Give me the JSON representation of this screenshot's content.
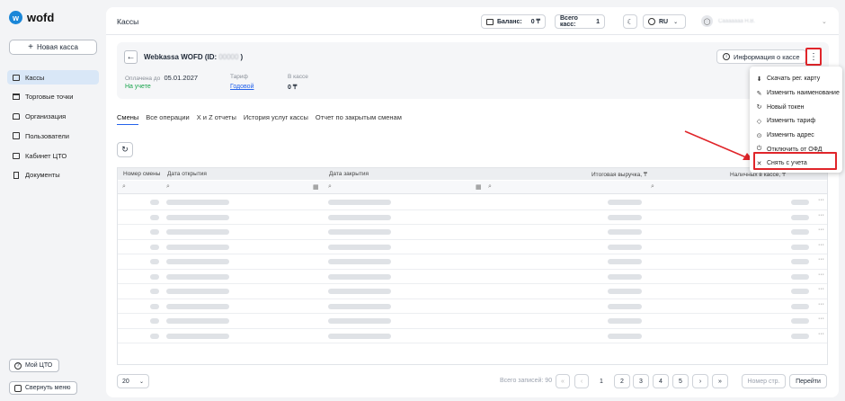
{
  "sidebar": {
    "logo": "wofd",
    "logo_mark": "w",
    "new_button": "Новая касса",
    "items": [
      {
        "label": "Кассы",
        "icon": "cash-register-icon",
        "active": true
      },
      {
        "label": "Торговые точки",
        "icon": "store-icon"
      },
      {
        "label": "Организация",
        "icon": "building-icon"
      },
      {
        "label": "Пользователи",
        "icon": "users-icon"
      },
      {
        "label": "Кабинет ЦТО",
        "icon": "briefcase-icon"
      },
      {
        "label": "Документы",
        "icon": "document-icon"
      }
    ],
    "my_cto": "Мой ЦТО",
    "collapse": "Свернуть меню"
  },
  "header": {
    "title": "Кассы",
    "balance_label": "Баланс:",
    "balance_value": "0 ₸",
    "total_label": "Всего касс:",
    "total_value": "1",
    "lang": "RU",
    "user_name": "Сааааааа Н.В."
  },
  "card": {
    "title": "Webkassa WOFD (ID:",
    "title_id": "00000",
    "title_close": ")",
    "info_button": "Информация о кассе",
    "paid_label": "Оплачена до",
    "paid_date": "05.01.2027",
    "status": "На учете",
    "tariff_label": "Тариф",
    "tariff_value": "Годовой",
    "cash_label": "В кассе",
    "cash_value": "0 ₸"
  },
  "tabs": [
    "Смены",
    "Все операции",
    "X и Z отчеты",
    "История услуг кассы",
    "Отчет по закрытым сменам"
  ],
  "table": {
    "columns": [
      "Номер смены",
      "Дата открытия",
      "Дата закрытия",
      "Итоговая выручка, ₸",
      "Наличных в кассе, ₸"
    ],
    "row_count": 10
  },
  "pagination": {
    "page_size": "20",
    "total": "Всего записей: 90",
    "pages": [
      "1",
      "2",
      "3",
      "4",
      "5"
    ],
    "page_input_placeholder": "Номер стр.",
    "go": "Перейти"
  },
  "menu": {
    "items": [
      {
        "label": "Скачать рег. карту",
        "icon": "download-icon"
      },
      {
        "label": "Изменить наименование",
        "icon": "pencil-icon"
      },
      {
        "label": "Новый токен",
        "icon": "refresh-icon"
      },
      {
        "label": "Изменить тариф",
        "icon": "tag-icon"
      },
      {
        "label": "Изменить адрес",
        "icon": "pin-icon"
      },
      {
        "label": "Отключить от ОФД",
        "icon": "power-icon"
      },
      {
        "label": "Снять с учета",
        "icon": "close-icon"
      }
    ]
  },
  "colors": {
    "accent": "#2563eb",
    "brand": "#1b87d8",
    "status_green": "#16a34a",
    "highlight_red": "#e0252a"
  }
}
